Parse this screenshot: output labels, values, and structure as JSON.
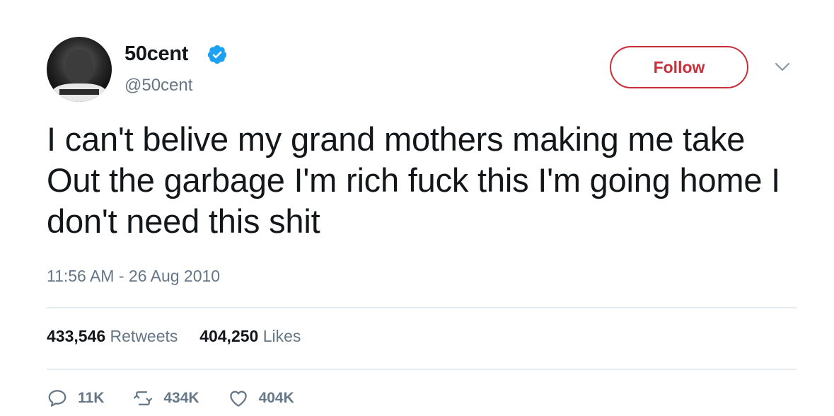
{
  "author": {
    "name": "50cent",
    "handle": "@50cent",
    "verified": true
  },
  "follow_label": "Follow",
  "tweet_text": "I can't belive my grand mothers making me take Out the garbage I'm rich fuck this I'm going home I don't need this shit",
  "timestamp": "11:56 AM - 26 Aug 2010",
  "stats": {
    "retweets_count": "433,546",
    "retweets_label": "Retweets",
    "likes_count": "404,250",
    "likes_label": "Likes"
  },
  "actions": {
    "reply_count": "11K",
    "retweet_count": "434K",
    "like_count": "404K"
  },
  "colors": {
    "follow_accent": "#c9303a",
    "verified_blue": "#1da1f2",
    "muted_text": "#657786",
    "primary_text": "#14171a"
  },
  "icons": {
    "reply": "reply-icon",
    "retweet": "retweet-icon",
    "like": "heart-icon",
    "verified": "verified-badge-icon",
    "menu": "chevron-down-icon"
  }
}
